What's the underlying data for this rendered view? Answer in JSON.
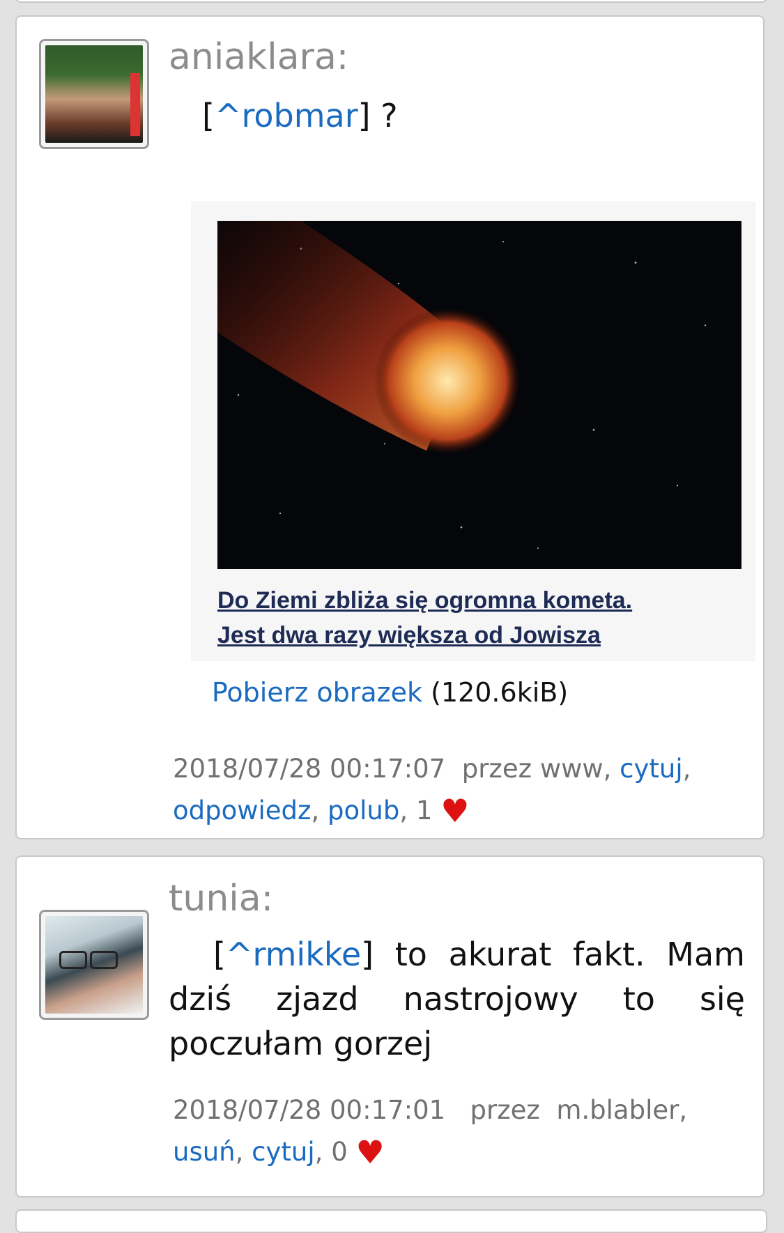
{
  "posts": [
    {
      "author": "aniaklara:",
      "mention_open": "[",
      "mention": "^robmar",
      "mention_close": "]",
      "text": " ?",
      "embed_caption_line1": "Do Ziemi zbliża się ogromna kometa.",
      "embed_caption_line2": "Jest dwa razy większa od Jowisza",
      "download_link": "Pobierz obrazek",
      "download_size": "(120.6kiB)",
      "timestamp": "2018/07/28 00:17:07",
      "via_prefix": "przez",
      "via": "www",
      "actions": [
        "cytuj",
        "odpowiedz",
        "polub"
      ],
      "likes": "1",
      "heart": "♥"
    },
    {
      "author": "tunia:",
      "mention_open": "[",
      "mention": "^rmikke",
      "mention_close": "]",
      "text": " to akurat fakt. Mam dziś zjazd nastrojowy to się poczułam gorzej",
      "timestamp": "2018/07/28 00:17:01",
      "via_prefix": "przez",
      "via": "m.blabler",
      "actions": [
        "usuń",
        "cytuj"
      ],
      "likes": "0",
      "heart": "♥"
    }
  ],
  "colors": {
    "link": "#1a6bc0",
    "heart": "#dd1111",
    "author": "#8c8c8c"
  }
}
